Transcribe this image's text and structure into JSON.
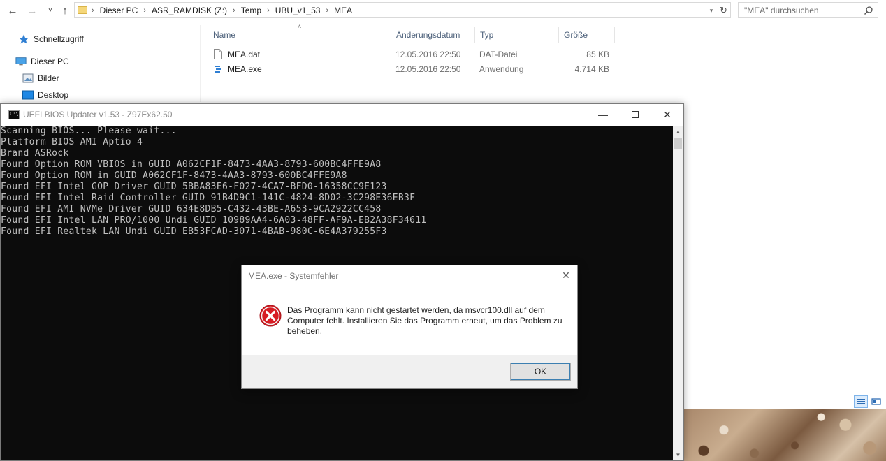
{
  "explorer": {
    "nav": {
      "back": "←",
      "forward": "→",
      "recent": "˅",
      "up": "↑"
    },
    "breadcrumb": [
      "Dieser PC",
      "ASR_RAMDISK (Z:)",
      "Temp",
      "UBU_v1_53",
      "MEA"
    ],
    "search_placeholder": "\"MEA\" durchsuchen",
    "sidebar": {
      "quick_access": "Schnellzugriff",
      "this_pc": "Dieser PC",
      "pictures": "Bilder",
      "desktop": "Desktop"
    },
    "columns": {
      "name": "Name",
      "date": "Änderungsdatum",
      "type": "Typ",
      "size": "Größe"
    },
    "files": [
      {
        "name": "MEA.dat",
        "date": "12.05.2016 22:50",
        "type": "DAT-Datei",
        "size": "85 KB",
        "icon": "dat-file-icon"
      },
      {
        "name": "MEA.exe",
        "date": "12.05.2016 22:50",
        "type": "Anwendung",
        "size": "4.714 KB",
        "icon": "exe-file-icon"
      }
    ]
  },
  "console": {
    "title": "UEFI BIOS Updater v1.53 - Z97Ex62.50",
    "lines": [
      "Scanning BIOS... Please wait...",
      "Platform BIOS AMI Aptio 4",
      "Brand ASRock",
      "Found Option ROM VBIOS in GUID A062CF1F-8473-4AA3-8793-600BC4FFE9A8",
      "Found Option ROM in GUID A062CF1F-8473-4AA3-8793-600BC4FFE9A8",
      "Found EFI Intel GOP Driver GUID 5BBA83E6-F027-4CA7-BFD0-16358CC9E123",
      "Found EFI Intel Raid Controller GUID 91B4D9C1-141C-4824-8D02-3C298E36EB3F",
      "Found EFI AMI NVMe Driver GUID 634E8DB5-C432-43BE-A653-9CA2922CC458",
      "Found EFI Intel LAN PRO/1000 Undi GUID 10989AA4-6A03-48FF-AF9A-EB2A38F34611",
      "Found EFI Realtek LAN Undi GUID EB53FCAD-3071-4BAB-980C-6E4A379255F3"
    ]
  },
  "dialog": {
    "title": "MEA.exe - Systemfehler",
    "message": "Das Programm kann nicht gestartet werden, da msvcr100.dll auf dem Computer fehlt. Installieren Sie das Programm erneut, um das Problem zu beheben.",
    "ok_label": "OK",
    "icon": "error-icon",
    "error_color": "#d71d24"
  },
  "colors": {
    "console_bg": "#0c0c0c",
    "console_fg": "#c0c0c0",
    "header_text": "#4c607a",
    "accent": "#1e78d7"
  }
}
